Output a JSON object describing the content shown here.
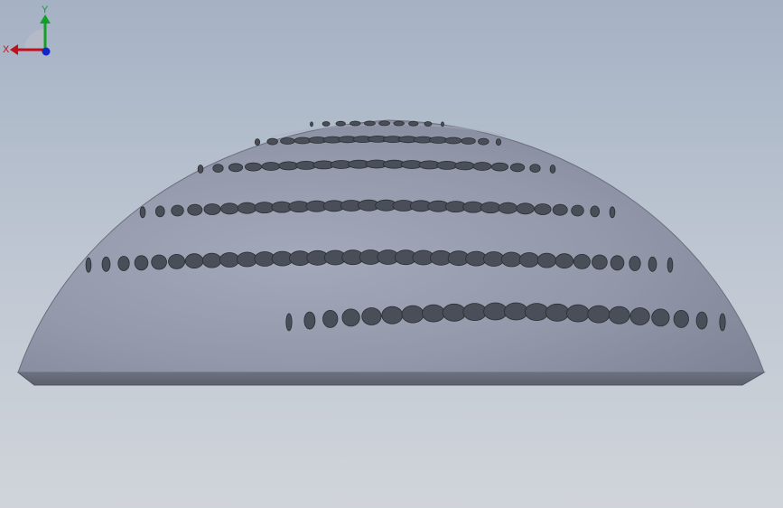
{
  "viewport": {
    "background_top": "#a5b2c4",
    "background_bottom": "#d0d4da",
    "model": {
      "part": "perforated-hemisphere-shell",
      "surface_color": "#9399aa",
      "edge_color": "#5f6371",
      "hole_fill": "#4a4e58",
      "hole_rows": 6
    },
    "triad": {
      "x_label": "X",
      "y_label": "Y",
      "x_color": "#c0101a",
      "y_color": "#12a028",
      "z_color": "#1028c8"
    }
  }
}
